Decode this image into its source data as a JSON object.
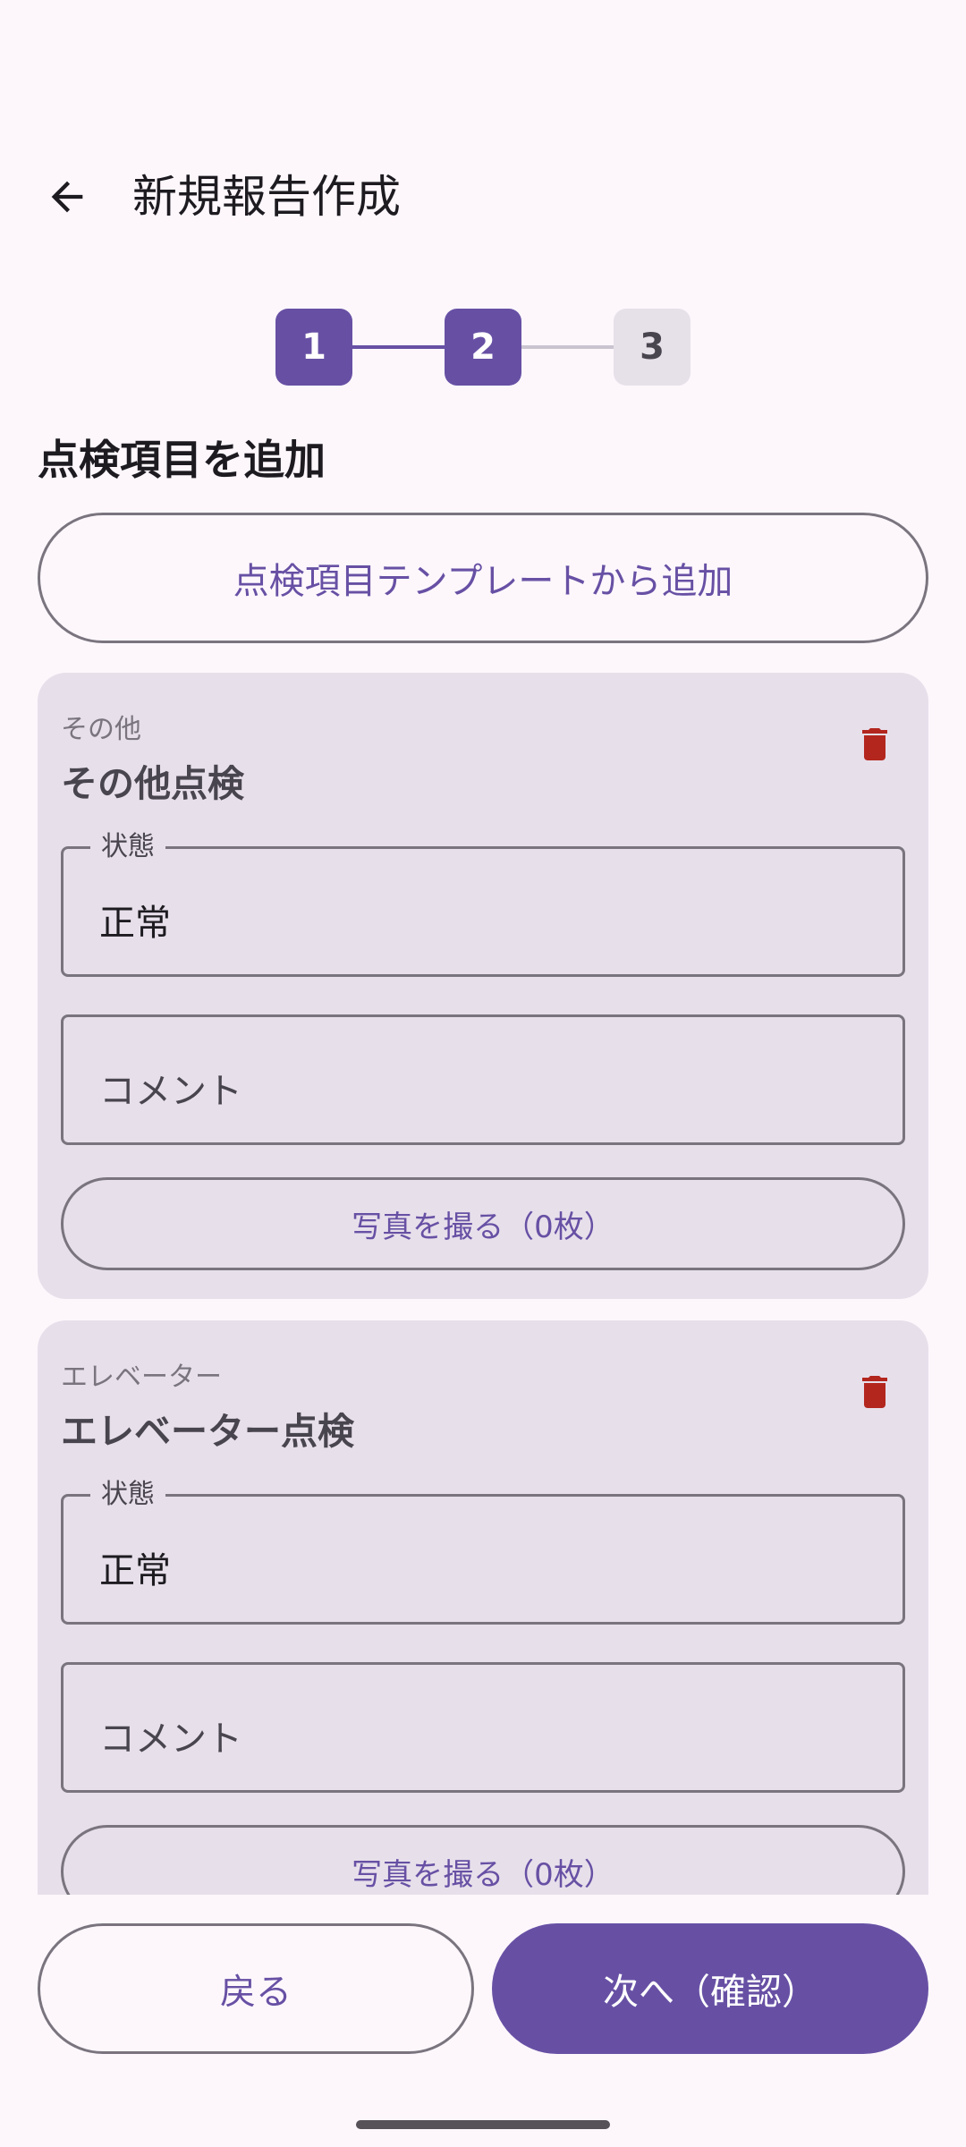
{
  "app_bar": {
    "title": "新規報告作成",
    "back_icon": "arrow-back-icon"
  },
  "stepper": {
    "steps": [
      {
        "label": "1",
        "state": "active"
      },
      {
        "label": "2",
        "state": "active"
      },
      {
        "label": "3",
        "state": "inactive"
      }
    ],
    "current_step": 2
  },
  "section": {
    "title": "点検項目を追加",
    "template_button": "点検項目テンプレートから追加"
  },
  "items": [
    {
      "category": "その他",
      "title": "その他点検",
      "status_label": "状態",
      "status_value": "正常",
      "comment_placeholder": "コメント",
      "photo_button": "写真を撮る（0枚）"
    },
    {
      "category": "エレベーター",
      "title": "エレベーター点検",
      "status_label": "状態",
      "status_value": "正常",
      "comment_placeholder": "コメント",
      "photo_button": "写真を撮る（0枚）"
    }
  ],
  "bottom": {
    "back_label": "戻る",
    "next_label": "次へ（確認）"
  },
  "colors": {
    "primary": "#6750a4",
    "delete": "#b3261e",
    "card_bg": "#e7e0eb",
    "background": "#fdf7fc"
  }
}
